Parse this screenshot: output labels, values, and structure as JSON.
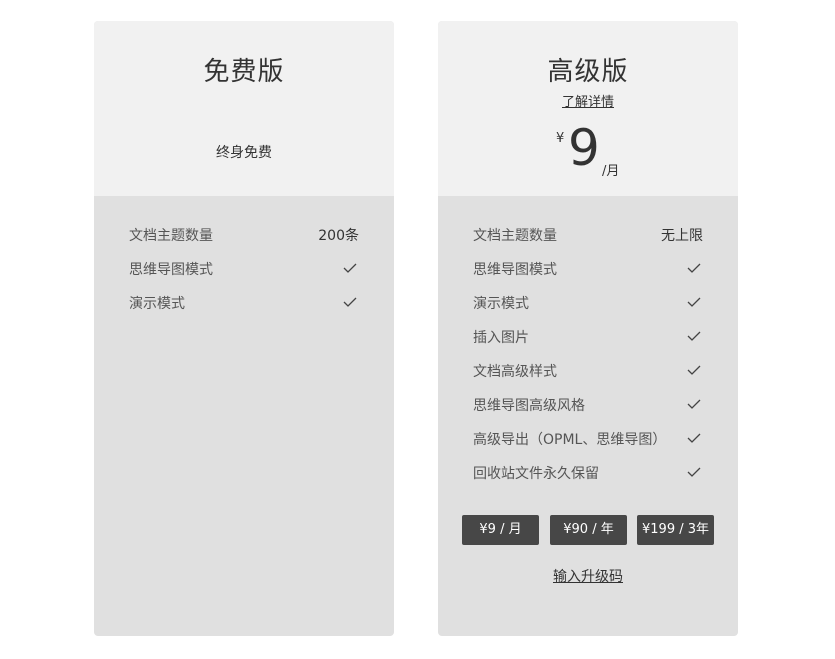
{
  "free_plan": {
    "title": "免费版",
    "subtitle": "终身免费",
    "features": [
      {
        "name": "文档主题数量",
        "value": "200条"
      },
      {
        "name": "思维导图模式",
        "check": true
      },
      {
        "name": "演示模式",
        "check": true
      }
    ]
  },
  "pro_plan": {
    "title": "高级版",
    "learn_more": "了解详情",
    "price": {
      "currency": "¥",
      "amount": "9",
      "unit": "/月"
    },
    "features": [
      {
        "name": "文档主题数量",
        "value": "无上限"
      },
      {
        "name": "思维导图模式",
        "check": true
      },
      {
        "name": "演示模式",
        "check": true
      },
      {
        "name": "插入图片",
        "check": true
      },
      {
        "name": "文档高级样式",
        "check": true
      },
      {
        "name": "思维导图高级风格",
        "check": true
      },
      {
        "name": "高级导出（OPML、思维导图）",
        "check": true
      },
      {
        "name": "回收站文件永久保留",
        "check": true
      }
    ],
    "buttons": [
      "¥9 / 月",
      "¥90 / 年",
      "¥199 / 3年"
    ],
    "upgrade_code_link": "输入升级码"
  },
  "colors": {
    "card_body": "#e0e0e0",
    "card_head": "#f1f1f1",
    "button_bg": "#474747",
    "button_text": "#ffffff"
  },
  "icons": {
    "check": "checkmark-icon"
  }
}
